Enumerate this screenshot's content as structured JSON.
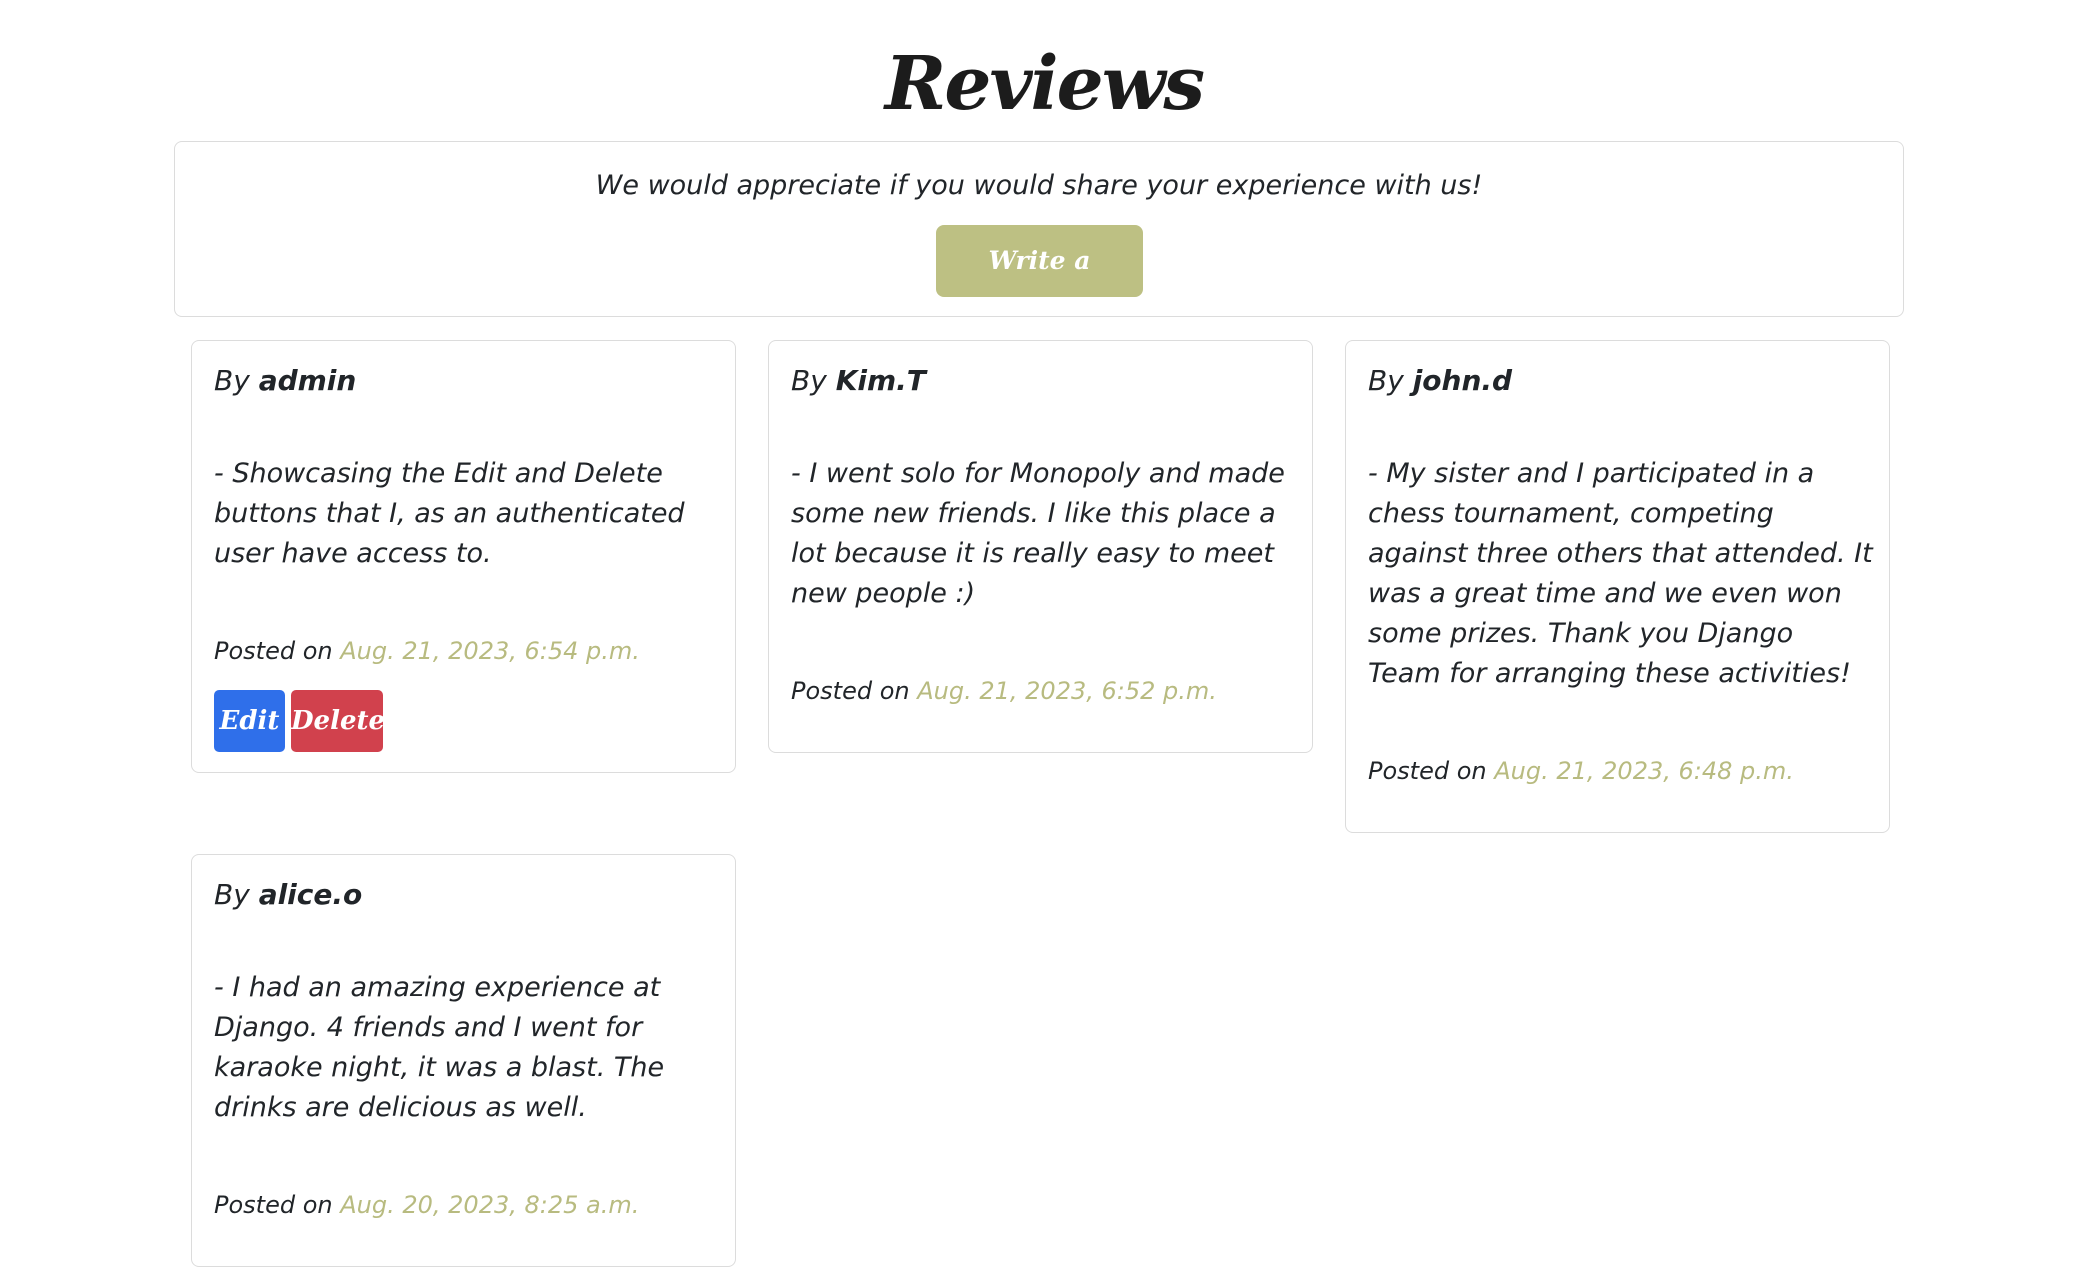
{
  "page": {
    "title": "Reviews"
  },
  "intro": {
    "text": "We would appreciate if you would share your experience with us!",
    "button_label": "Write a Review"
  },
  "labels": {
    "by": "By",
    "posted_on": "Posted on"
  },
  "colors": {
    "accent": "#bdc083",
    "date_text": "#b8bb80",
    "edit_button": "#2f6fea",
    "delete_button": "#d1414d",
    "card_border": "#dcdcdc"
  },
  "reviews": [
    {
      "author": "admin",
      "body": "- Showcasing the Edit and Delete buttons that I, as an authenticated user have access to.",
      "date": "Aug. 21, 2023, 6:54 p.m.",
      "edit_label": "Edit",
      "delete_label": "Delete"
    },
    {
      "author": "Kim.T",
      "body": "- I went solo for Monopoly and made some new friends. I like this place a lot because it is really easy to meet new people :)",
      "date": "Aug. 21, 2023, 6:52 p.m."
    },
    {
      "author": "john.d",
      "body": "- My sister and I participated in a chess tournament, competing against three others that attended. It was a great time and we even won some prizes. Thank you Django Team for arranging these activities!",
      "date": "Aug. 21, 2023, 6:48 p.m."
    },
    {
      "author": "alice.o",
      "body": "- I had an amazing experience at Django. 4 friends and I went for karaoke night, it was a blast. The drinks are delicious as well.",
      "date": "Aug. 20, 2023, 8:25 a.m."
    }
  ]
}
